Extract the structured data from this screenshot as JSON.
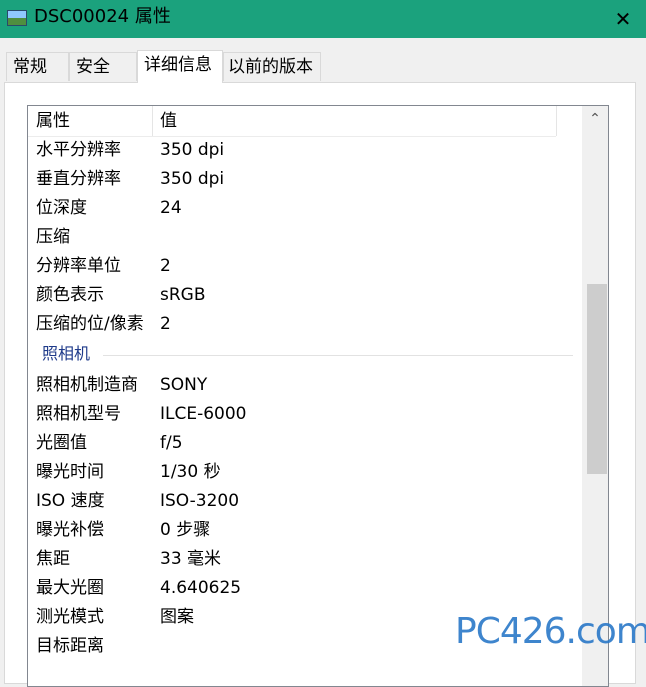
{
  "window": {
    "title": "DSC00024 属性",
    "close_glyph": "✕"
  },
  "tabs": [
    {
      "label": "常规"
    },
    {
      "label": "安全"
    },
    {
      "label": "详细信息"
    },
    {
      "label": "以前的版本"
    }
  ],
  "columns": {
    "property": "属性",
    "value": "值"
  },
  "image_rows": [
    {
      "key": "水平分辨率",
      "value": "350 dpi"
    },
    {
      "key": "垂直分辨率",
      "value": "350 dpi"
    },
    {
      "key": "位深度",
      "value": "24"
    },
    {
      "key": "压缩",
      "value": ""
    },
    {
      "key": "分辨率单位",
      "value": "2"
    },
    {
      "key": "颜色表示",
      "value": "sRGB"
    },
    {
      "key": "压缩的位/像素",
      "value": "2"
    }
  ],
  "camera_group": {
    "label": "照相机"
  },
  "camera_rows": [
    {
      "key": "照相机制造商",
      "value": "SONY"
    },
    {
      "key": "照相机型号",
      "value": "ILCE-6000"
    },
    {
      "key": "光圈值",
      "value": "f/5"
    },
    {
      "key": "曝光时间",
      "value": "1/30 秒"
    },
    {
      "key": "ISO 速度",
      "value": "ISO-3200"
    },
    {
      "key": "曝光补偿",
      "value": "0 步骤"
    },
    {
      "key": "焦距",
      "value": "33 毫米"
    },
    {
      "key": "最大光圈",
      "value": "4.640625"
    },
    {
      "key": "测光模式",
      "value": "图案"
    },
    {
      "key": "目标距离",
      "value": ""
    }
  ],
  "scrollbar": {
    "up_glyph": "⌃"
  },
  "watermark": {
    "text": "PC426.com"
  },
  "colors": {
    "titlebar": "#1ba27d",
    "group_label": "#1e3a8a"
  }
}
